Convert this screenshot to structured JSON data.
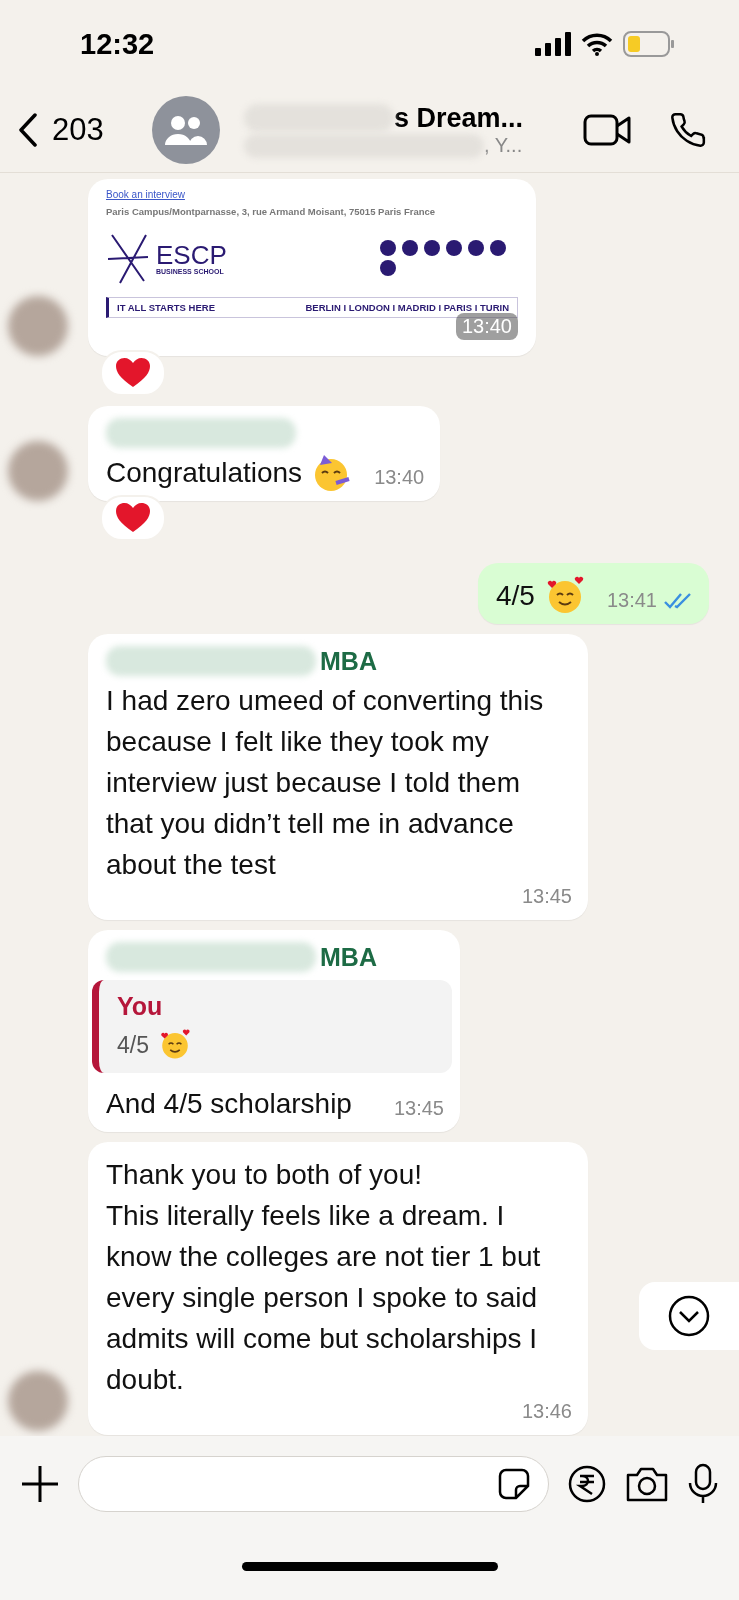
{
  "status_bar": {
    "time": "12:32"
  },
  "header": {
    "back_count": "203",
    "title": "s Dream...",
    "subtitle": ", Y..."
  },
  "messages": [
    {
      "kind": "image",
      "outgoing": false,
      "avatar": true,
      "reacted": true,
      "link": "Book an interview",
      "address": "Paris Campus/Montparnasse, 3, rue Armand Moisant, 75015 Paris France",
      "logo": "ESCP",
      "logo_subtitle": "BUSINESS SCHOOL",
      "tagline": "IT ALL STARTS HERE",
      "cities": "BERLIN I LONDON I MADRID I PARIS I TURIN",
      "time": "13:40"
    },
    {
      "kind": "text",
      "outgoing": false,
      "avatar": true,
      "reacted": true,
      "sender_blurred": true,
      "paragraphs": [
        "Congratulations"
      ],
      "emoji": {
        "kind": "party"
      },
      "time": "13:40"
    },
    {
      "kind": "text",
      "outgoing": true,
      "avatar": false,
      "reacted": false,
      "paragraphs": [
        "4/5"
      ],
      "emoji": {
        "kind": "hearts"
      },
      "time": "13:41",
      "read": true
    },
    {
      "kind": "text",
      "outgoing": false,
      "avatar": false,
      "reacted": false,
      "sender_blurred": true,
      "sender": "MBA",
      "paragraphs": [
        "I had zero umeed of converting this because I felt like they took my interview just because I told them that you didn’t tell me in advance about the test"
      ],
      "time": "13:45"
    },
    {
      "kind": "reply",
      "outgoing": false,
      "avatar": false,
      "reacted": false,
      "sender_blurred": true,
      "sender": "MBA",
      "quote": {
        "author": "You",
        "text": "4/5",
        "emoji": {
          "kind": "hearts"
        }
      },
      "paragraphs": [
        "And 4/5 scholarship"
      ],
      "time": "13:45"
    },
    {
      "kind": "text",
      "outgoing": false,
      "avatar": true,
      "reacted": false,
      "paragraphs": [
        "Thank you to both of you!",
        "This literally feels like a dream. I know the colleges are not tier 1 but every single person I spoke to said admits will come but scholarships I doubt."
      ],
      "time": "13:46"
    }
  ]
}
